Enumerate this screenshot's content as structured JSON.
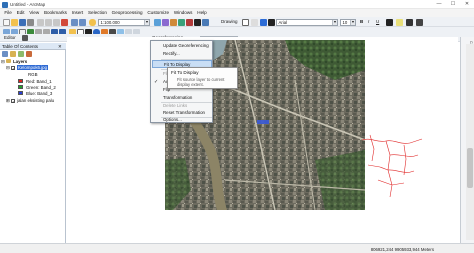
{
  "window": {
    "title": "Untitled - ArcMap",
    "minimize_glyph": "—",
    "maximize_glyph": "☐",
    "close_glyph": "✕"
  },
  "menubar": [
    "File",
    "Edit",
    "View",
    "Bookmarks",
    "Insert",
    "Selection",
    "Geoprocessing",
    "Customize",
    "Windows",
    "Help"
  ],
  "toolbar": {
    "scale": "1:100.000",
    "drawing_label": "Drawing",
    "font_name": "Arial",
    "font_size": "10",
    "bold": "B",
    "italic": "I",
    "underline": "U",
    "editor_label": "Editor",
    "georeferencing_label": "Georeferencing",
    "georef_layer": "Kelompok6.jpg"
  },
  "toc": {
    "title": "Table Of Contents",
    "layers_label": "Layers",
    "raster_layer": "Kelompok6.jpg",
    "rgb_label": "RGB",
    "bands": [
      {
        "label": "Red:   Band_1",
        "color": "#e0201e"
      },
      {
        "label": "Green: Band_2",
        "color": "#22a02a"
      },
      {
        "label": "Blue:  Band_3",
        "color": "#2a3fd6"
      }
    ],
    "vector_layer": "jalan eksisting palu"
  },
  "georef_menu": {
    "items": [
      {
        "label": "Update Georeferencing",
        "state": "normal"
      },
      {
        "label": "Rectify...",
        "state": "normal"
      },
      {
        "label": "Fit To Display",
        "state": "highlighted"
      },
      {
        "label": "Flip or Rotate",
        "state": "normal"
      },
      {
        "label": "Auto Adjust",
        "state": "checked"
      },
      {
        "label": "Flip",
        "state": "normal"
      },
      {
        "label": "Transformation",
        "state": "normal"
      },
      {
        "label": "Delete Links",
        "state": "disabled"
      },
      {
        "label": "Reset Transformation",
        "state": "normal"
      },
      {
        "label": "Options...",
        "state": "normal"
      }
    ]
  },
  "tooltip": {
    "title": "Fit To Display",
    "description": "Fit source layer to current display extent."
  },
  "status": {
    "coords": "806921,244  9905933,944 Meters"
  },
  "right_panel": {
    "tabs": [
      "Catalog",
      "Search",
      "ArcToolbox",
      "Create Features"
    ]
  }
}
